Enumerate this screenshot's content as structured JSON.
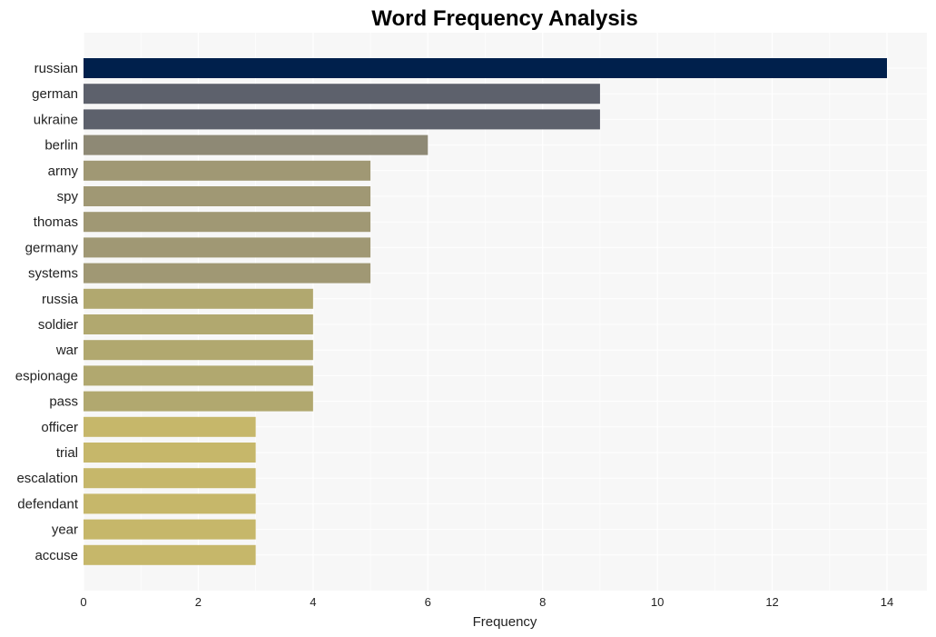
{
  "chart_data": {
    "type": "bar",
    "orientation": "horizontal",
    "title": "Word Frequency Analysis",
    "xlabel": "Frequency",
    "ylabel": "",
    "xlim": [
      0,
      14.7
    ],
    "xticks": [
      0,
      2,
      4,
      6,
      8,
      10,
      12,
      14
    ],
    "grid": true,
    "legend": "none",
    "categories": [
      "russian",
      "german",
      "ukraine",
      "berlin",
      "army",
      "spy",
      "thomas",
      "germany",
      "systems",
      "russia",
      "soldier",
      "war",
      "espionage",
      "pass",
      "officer",
      "trial",
      "escalation",
      "defendant",
      "year",
      "accuse"
    ],
    "values": [
      14,
      9,
      9,
      6,
      5,
      5,
      5,
      5,
      5,
      4,
      4,
      4,
      4,
      4,
      3,
      3,
      3,
      3,
      3,
      3
    ],
    "colors": {
      "14": "#00204c",
      "9": "#5d616c",
      "6": "#8e8975",
      "5": "#a09874",
      "4": "#b1a86f",
      "3": "#c6b76a"
    },
    "plot_background": "#f7f7f7",
    "grid_color": "#ffffff"
  }
}
